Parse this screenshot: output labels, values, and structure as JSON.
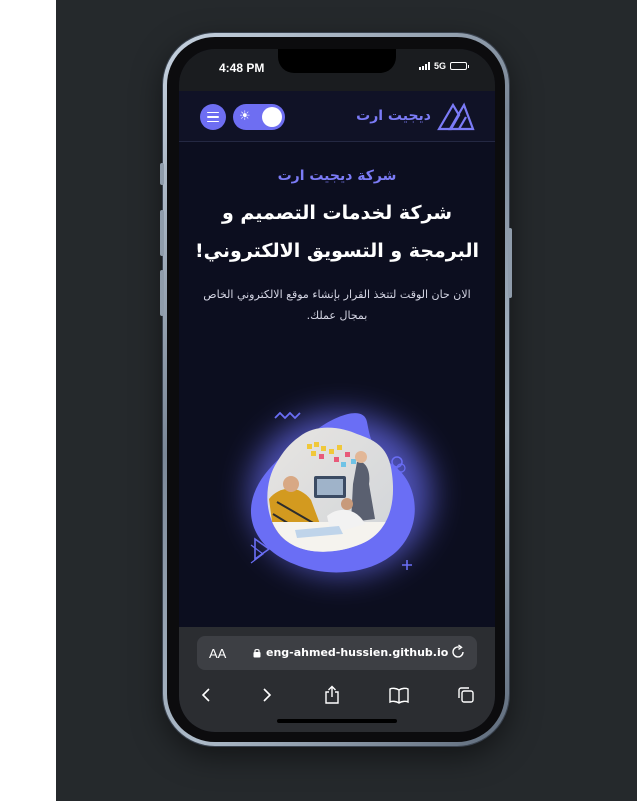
{
  "status_bar": {
    "time": "4:48 PM",
    "network": "5G",
    "battery_level": 0.9
  },
  "navbar": {
    "brand_name": "ديجيت ارت",
    "theme_icon": "sun-icon",
    "menu_icon": "hamburger-icon",
    "theme_toggle_on": true
  },
  "hero": {
    "subtitle": "شركة ديجيت ارت",
    "headline_line1": "شركة لخدمات التصميم و",
    "headline_line2": "البرمجة و التسويق الالكتروني!",
    "description": "الان حان الوقت لتتخذ القرار بإنشاء موقع الالكتروني الخاص بمجال عملك."
  },
  "browser": {
    "text_size_label": "AA",
    "url": "eng-ahmed-hussien.github.io",
    "toolbar": [
      "back-icon",
      "forward-icon",
      "share-icon",
      "bookmarks-icon",
      "tabs-icon"
    ]
  },
  "colors": {
    "accent": "#6e6ef2",
    "page_bg": "#0c0e1f",
    "navbar_bg": "#101226",
    "stage_bg": "#25292c"
  }
}
